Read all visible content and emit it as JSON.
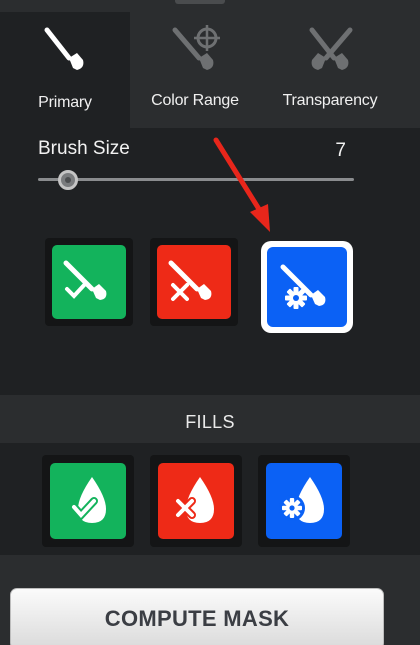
{
  "tabs": [
    {
      "label": "Primary",
      "icon": "brush-icon",
      "active": true
    },
    {
      "label": "Color Range",
      "icon": "brush-target-icon",
      "active": false
    },
    {
      "label": "Transparency",
      "icon": "crossed-brushes-icon",
      "active": false
    }
  ],
  "brush": {
    "label": "Brush Size",
    "value": "7",
    "level": 0.1
  },
  "brush_tools": [
    {
      "name": "keep-brush",
      "icon": "brush-check-icon",
      "color": "#13b35c"
    },
    {
      "name": "remove-brush",
      "icon": "brush-x-icon",
      "color": "#ee2a17"
    },
    {
      "name": "auto-brush",
      "icon": "brush-gear-icon",
      "color": "#0b61f5",
      "selected": true
    }
  ],
  "fills": {
    "title": "FILLS",
    "items": [
      {
        "name": "keep-fill",
        "icon": "drop-check-icon",
        "color": "#13b35c"
      },
      {
        "name": "remove-fill",
        "icon": "drop-x-icon",
        "color": "#ee2a17"
      },
      {
        "name": "auto-fill",
        "icon": "drop-gear-icon",
        "color": "#0b61f5"
      }
    ]
  },
  "compute_button": "COMPUTE MASK",
  "annotation": {
    "type": "arrow",
    "color": "#e8261b"
  }
}
